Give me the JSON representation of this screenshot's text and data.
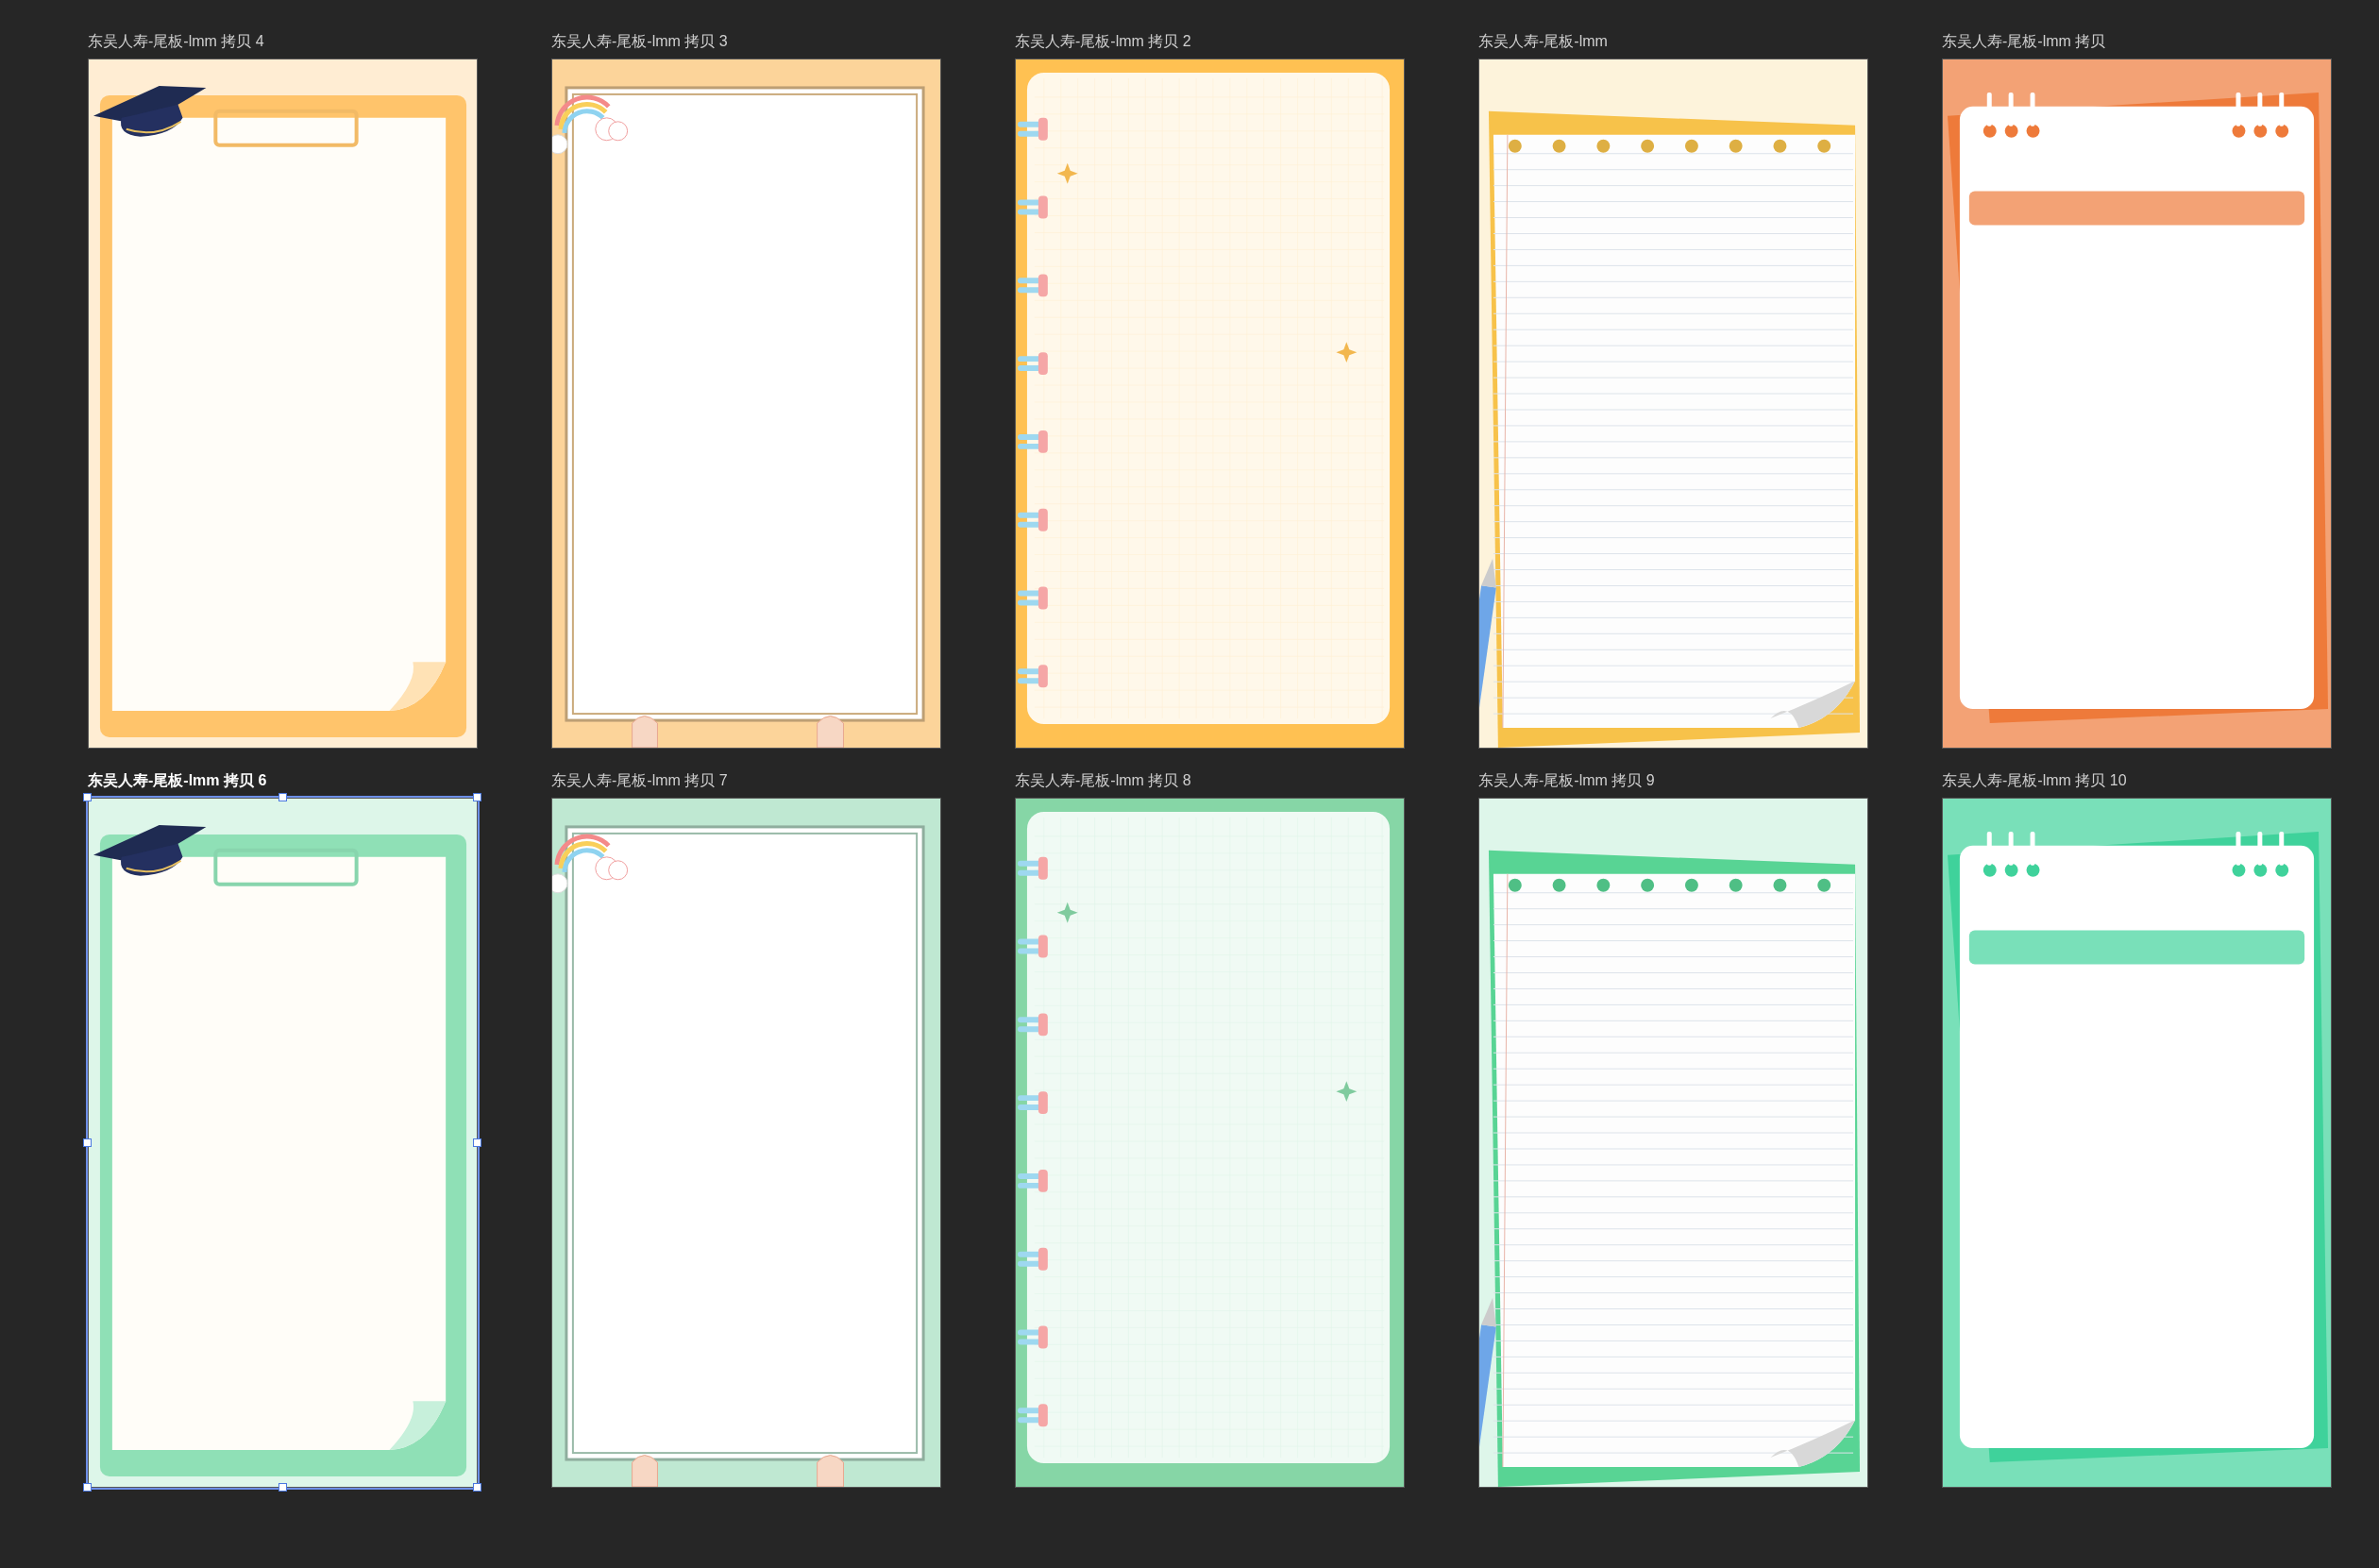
{
  "artboards": [
    {
      "label": "东吴人寿-尾板-lmm 拷贝 4",
      "kind": "clipboard",
      "color": "#ffc46b",
      "selected": false
    },
    {
      "label": "东吴人寿-尾板-lmm 拷贝 3",
      "kind": "rainbow-frame",
      "color": "#fcd49a",
      "selected": false
    },
    {
      "label": "东吴人寿-尾板-lmm 拷贝 2",
      "kind": "binder",
      "color": "#ffc152",
      "selected": false
    },
    {
      "label": "东吴人寿-尾板-lmm",
      "kind": "lined-paper",
      "color": "#f7c24a",
      "selected": false
    },
    {
      "label": "东吴人寿-尾板-lmm 拷贝",
      "kind": "notepad",
      "color": "#ee7a3a",
      "selected": false
    },
    {
      "label": "东吴人寿-尾板-lmm 拷贝 6",
      "kind": "clipboard",
      "color": "#8fe0b6",
      "selected": true
    },
    {
      "label": "东吴人寿-尾板-lmm 拷贝 7",
      "kind": "rainbow-frame",
      "color": "#bfe8d2",
      "selected": false
    },
    {
      "label": "东吴人寿-尾板-lmm 拷贝 8",
      "kind": "binder",
      "color": "#86d6a6",
      "selected": false
    },
    {
      "label": "东吴人寿-尾板-lmm 拷贝 9",
      "kind": "lined-paper",
      "color": "#58d494",
      "selected": false
    },
    {
      "label": "东吴人寿-尾板-lmm 拷贝 10",
      "kind": "notepad",
      "color": "#3fd29b",
      "selected": false
    }
  ]
}
